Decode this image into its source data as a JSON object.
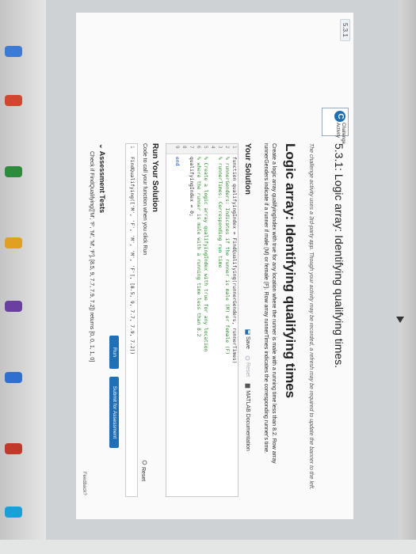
{
  "page": {
    "nav_badge": "5.3.1",
    "challenge_badge_line1": "Challenge",
    "challenge_badge_line2": "Activity",
    "activity_title": "5.3.1: Logic array: Identifying qualifying times.",
    "notice": "The challenge activity uses a 3rd-party app. Though your activity may be recorded, a refresh may be required to update the banner to the left.",
    "main_title": "Logic array: Identifying qualifying times",
    "description": "Create a logic array qualifyingIndex with true for any location where the runner is male with a running time less than 8.2. Row array runnerGenders indicate if a runner if male (M) or female (F). Row array runnerTimes indicates the corresponding runner's time.",
    "your_solution": "Your Solution",
    "toolbar": {
      "save": "Save",
      "reset": "Reset",
      "matlab_doc": "MATLAB Documentation"
    },
    "code_lines": [
      {
        "num": "1",
        "text": "function qualifyingIndex = FindQualifying(runnerGenders, runnerTimes)"
      },
      {
        "num": "2",
        "text": "% runnerGenders: Indicates if the runner is male (M) or female (F)"
      },
      {
        "num": "3",
        "text": "% runnerTimes: Corresponding run time"
      },
      {
        "num": "4",
        "text": ""
      },
      {
        "num": "5",
        "text": "% Create a logic array qualifyingIndex with true for any location"
      },
      {
        "num": "6",
        "text": "% where the runner is male with a running time less than 8.2"
      },
      {
        "num": "7",
        "text": "qualifyingIndex = 0;"
      },
      {
        "num": "8",
        "text": ""
      },
      {
        "num": "9",
        "text": "end"
      }
    ],
    "run_title": "Run Your Solution",
    "run_sub": "Code to call your function when you click Run",
    "run_reset": "Reset",
    "run_code": {
      "num": "1",
      "text": "FindQualifying(['M', 'F', 'M', 'M', 'F'], [8.5, 9, 7.7, 7.9, 7.2])"
    },
    "run_button": "Run",
    "submit_button": "Submit for Assessment",
    "assessment_title": "Assessment Tests",
    "assessment_check": "Check if FindQualifying(['M', 'F', 'M', 'M', 'F'], [8.5, 9, 7.7, 7.9, 7.2]) returns [0, 0, 1, 1, 0]",
    "feedback": "Feedback?"
  },
  "colors": {
    "accent": "#1f6eb8",
    "comment": "#2a8a2a",
    "keyword": "#1b47c4"
  }
}
